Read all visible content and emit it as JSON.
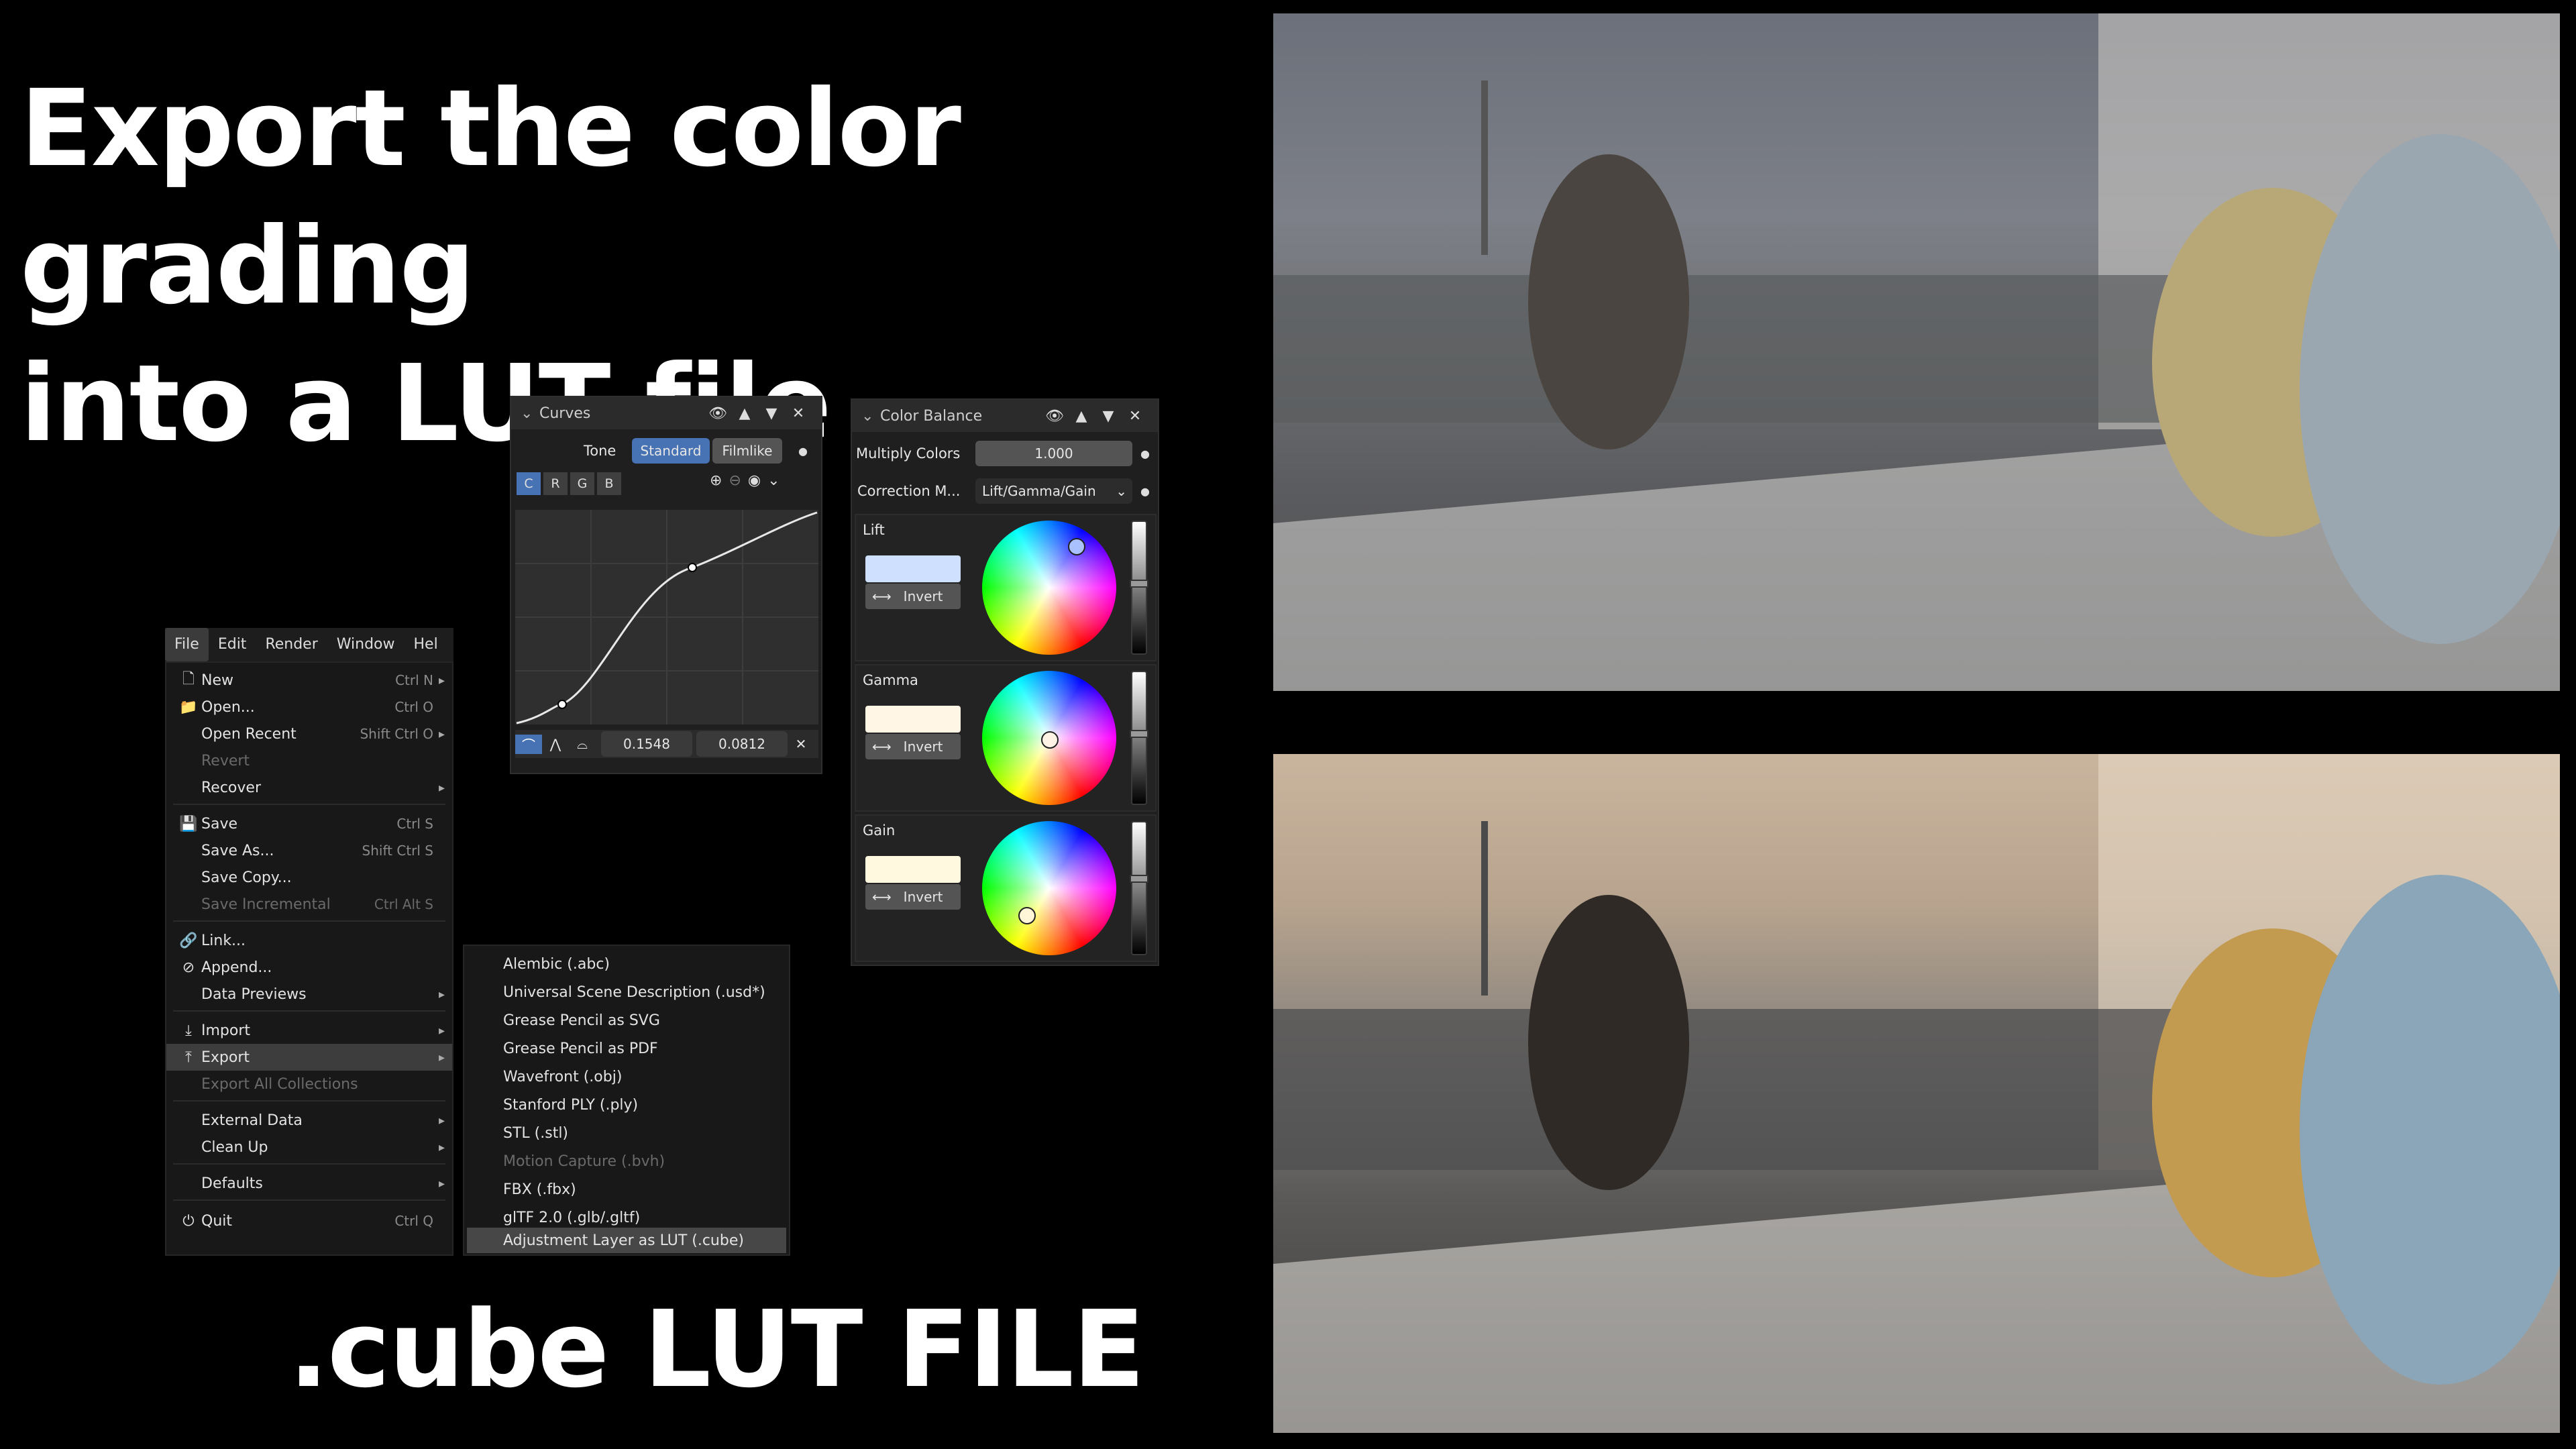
{
  "headline": {
    "line1": "Export the color grading",
    "line2": "into a LUT file"
  },
  "footer_title": ".cube LUT FILE",
  "menubar": [
    "File",
    "Edit",
    "Render",
    "Window",
    "Help"
  ],
  "file_menu": [
    {
      "label": "New",
      "shortcut": "Ctrl N",
      "icon": "new-file-icon",
      "sub": true
    },
    {
      "label": "Open...",
      "shortcut": "Ctrl O",
      "icon": "folder-icon"
    },
    {
      "label": "Open Recent",
      "shortcut": "Shift Ctrl O",
      "sub": true
    },
    {
      "label": "Revert",
      "disabled": true
    },
    {
      "label": "Recover",
      "sub": true
    },
    {
      "label": "Save",
      "shortcut": "Ctrl S",
      "icon": "save-icon"
    },
    {
      "label": "Save As...",
      "shortcut": "Shift Ctrl S"
    },
    {
      "label": "Save Copy..."
    },
    {
      "label": "Save Incremental",
      "shortcut": "Ctrl Alt S",
      "disabled": true
    },
    {
      "label": "Link...",
      "icon": "link-icon"
    },
    {
      "label": "Append...",
      "icon": "append-icon"
    },
    {
      "label": "Data Previews",
      "sub": true
    },
    {
      "label": "Import",
      "icon": "import-icon",
      "sub": true
    },
    {
      "label": "Export",
      "icon": "export-icon",
      "sub": true,
      "highlight": true
    },
    {
      "label": "Export All Collections",
      "disabled": true
    },
    {
      "label": "External Data",
      "sub": true
    },
    {
      "label": "Clean Up",
      "sub": true
    },
    {
      "label": "Defaults",
      "sub": true
    },
    {
      "label": "Quit",
      "shortcut": "Ctrl Q",
      "icon": "power-icon"
    }
  ],
  "export_submenu": [
    {
      "label": "Alembic (.abc)"
    },
    {
      "label": "Universal Scene Description (.usd*)"
    },
    {
      "label": "Grease Pencil as SVG"
    },
    {
      "label": "Grease Pencil as PDF"
    },
    {
      "label": "Wavefront (.obj)"
    },
    {
      "label": "Stanford PLY (.ply)"
    },
    {
      "label": "STL (.stl)"
    },
    {
      "label": "Motion Capture (.bvh)",
      "disabled": true
    },
    {
      "label": "FBX (.fbx)"
    },
    {
      "label": "glTF 2.0 (.glb/.gltf)"
    },
    {
      "label": "Adjustment Layer as LUT (.cube)",
      "highlight": true
    }
  ],
  "curves": {
    "title": "Curves",
    "tone_label": "Tone",
    "tone_options": [
      "Standard",
      "Filmlike"
    ],
    "channels": [
      "C",
      "R",
      "G",
      "B"
    ],
    "point_x": "0.1548",
    "point_y": "0.0812"
  },
  "color_balance": {
    "title": "Color Balance",
    "multiply_label": "Multiply Colors",
    "multiply_value": "1.000",
    "correction_label": "Correction M...",
    "correction_value": "Lift/Gamma/Gain",
    "wheels": [
      {
        "label": "Lift",
        "swatch": "#cfe0ff",
        "invert": "Invert"
      },
      {
        "label": "Gamma",
        "swatch": "#fff6e6",
        "invert": "Invert"
      },
      {
        "label": "Gain",
        "swatch": "#fff9df",
        "invert": "Invert"
      }
    ]
  }
}
